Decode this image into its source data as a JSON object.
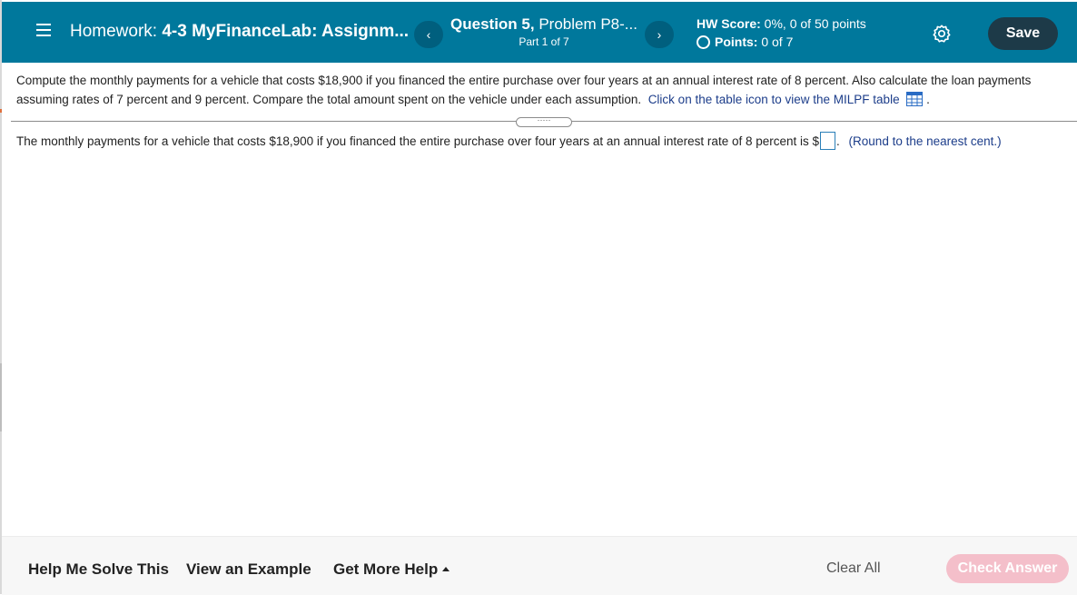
{
  "header": {
    "homework_prefix": "Homework:",
    "homework_name": "4-3 MyFinanceLab: Assignm...",
    "prev_label": "‹",
    "next_label": "›",
    "question_bold": "Question 5,",
    "question_rest": " Problem P8-...",
    "part": "Part 1 of 7",
    "hw_score_label": "HW Score:",
    "hw_score_value": " 0%, 0 of 50 points",
    "points_label": "Points:",
    "points_value": " 0 of 7",
    "save_label": "Save"
  },
  "question": {
    "text": "Compute the monthly payments for a vehicle that costs $18,900 if you financed the entire purchase over four years at an annual interest rate of 8 percent. Also calculate the loan payments assuming rates of 7 percent and 9 percent. Compare the total amount spent on the vehicle under each assumption.",
    "link_text": "Click on the table icon to view the MILPF table",
    "after_icon": "."
  },
  "answer": {
    "prefix": "The monthly payments for a vehicle that costs $18,900 if you financed the entire purchase over four years at an annual interest rate of 8 percent is $",
    "suffix": ".",
    "hint": "(Round to the nearest cent.)"
  },
  "footer": {
    "help_solve": "Help Me Solve This",
    "view_example": "View an Example",
    "more_help": "Get More Help",
    "clear_all": "Clear All",
    "check_answer": "Check Answer"
  },
  "colors": {
    "header_bg": "#00789c",
    "save_bg": "#1d3a48",
    "check_bg": "#f4bfca",
    "link": "#1c3d8a",
    "input_border": "#2b7fb8"
  },
  "icons": [
    "menu-icon",
    "chevron-left-icon",
    "chevron-right-icon",
    "gear-icon",
    "table-grid-icon",
    "caret-up-icon"
  ]
}
